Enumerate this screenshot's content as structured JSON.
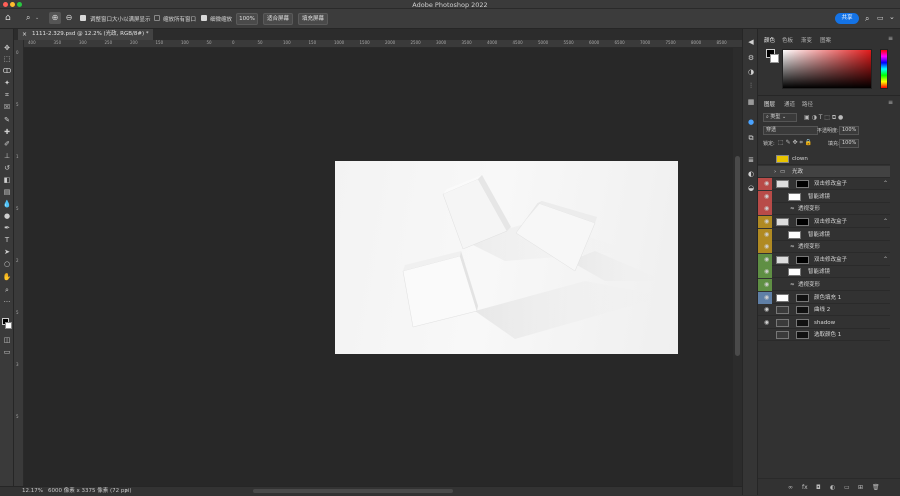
{
  "app": {
    "title": "Adobe Photoshop 2022"
  },
  "options_bar": {
    "resize_windows_label": "调整窗口大小以满屏显示",
    "zoom_all_label": "缩放所有窗口",
    "scrubby_zoom_label": "细微缩放",
    "zoom_value": "100%",
    "fit_screen_label": "适合屏幕",
    "fill_screen_label": "填充屏幕",
    "share_label": "共享"
  },
  "document": {
    "tab_title": "1111-2.329.psd @ 12.2% (光政, RGB/8#) *",
    "zoom_status": "12.17%",
    "size_status": "6000 像素 x 3375 像素 (72 ppi)"
  },
  "ruler": {
    "h_ticks": [
      "400",
      "350",
      "300",
      "250",
      "200",
      "150",
      "100",
      "50",
      "0",
      "50",
      "100",
      "150",
      "1000",
      "1500",
      "2000",
      "2500",
      "3000",
      "3500",
      "4000",
      "4500",
      "5000",
      "5500",
      "6000",
      "6500",
      "7000",
      "7500",
      "8000",
      "8500",
      "9000",
      "9500"
    ],
    "v_ticks": [
      "0",
      "5",
      "1",
      "5",
      "2",
      "5",
      "3",
      "5"
    ]
  },
  "color_panel": {
    "tabs": [
      "颜色",
      "色板",
      "渐变",
      "图案"
    ],
    "foreground": "#000000",
    "background": "#ffffff"
  },
  "layers_panel": {
    "tabs": [
      "图层",
      "通道",
      "路径"
    ],
    "filter_label": "类型",
    "blend_mode": "穿透",
    "opacity_label": "不透明度:",
    "opacity_value": "100%",
    "lock_label": "锁定:",
    "fill_label": "填充:",
    "fill_value": "100%",
    "layers": [
      {
        "name": "clown",
        "visible": false,
        "color": "",
        "kind": "text"
      },
      {
        "name": "光政",
        "visible": false,
        "color": "",
        "kind": "group"
      },
      {
        "name": "双击修改盒子",
        "visible": true,
        "color": "#b84b48",
        "kind": "smart"
      },
      {
        "name": "智能滤镜",
        "visible": true,
        "color": "#b84b48",
        "kind": "filter"
      },
      {
        "name": "透视变形",
        "visible": true,
        "color": "#b84b48",
        "kind": "effect"
      },
      {
        "name": "双击修改盒子",
        "visible": true,
        "color": "#b08a22",
        "kind": "smart"
      },
      {
        "name": "智能滤镜",
        "visible": true,
        "color": "#b08a22",
        "kind": "filter"
      },
      {
        "name": "透视变形",
        "visible": true,
        "color": "#b08a22",
        "kind": "effect"
      },
      {
        "name": "双击修改盒子",
        "visible": true,
        "color": "#5f8f44",
        "kind": "smart"
      },
      {
        "name": "智能滤镜",
        "visible": true,
        "color": "#5f8f44",
        "kind": "filter"
      },
      {
        "name": "透视变形",
        "visible": true,
        "color": "#5f8f44",
        "kind": "effect"
      },
      {
        "name": "颜色填充 1",
        "visible": true,
        "color": "#5f7fa6",
        "kind": "fill"
      },
      {
        "name": "曲线 2",
        "visible": true,
        "color": "",
        "kind": "adjust"
      },
      {
        "name": "shadow",
        "visible": true,
        "color": "",
        "kind": "adjust"
      },
      {
        "name": "选取颜色 1",
        "visible": false,
        "color": "",
        "kind": "adjust"
      }
    ]
  }
}
